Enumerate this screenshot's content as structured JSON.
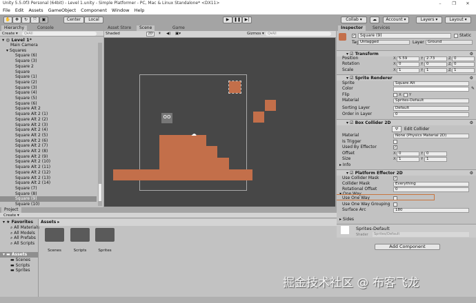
{
  "window": {
    "title": "Unity 5.5.0f3 Personal (64bit) - Level 1.unity - Simple Platformer - PC, Mac & Linux Standalone* <DX11>",
    "min": "–",
    "max": "❐",
    "close": "✕"
  },
  "menu": [
    "File",
    "Edit",
    "Assets",
    "GameObject",
    "Component",
    "Window",
    "Help"
  ],
  "toolbar": {
    "center": "Center",
    "local": "Local",
    "collab": "Collab ▾",
    "account": "Account ▾",
    "layers": "Layers ▾",
    "layout": "Layout ▾"
  },
  "hierarchy": {
    "tab": "Hierarchy",
    "console_tab": "Console",
    "create": "Create ▾",
    "search": "Q▾All",
    "scene": "Level 1*",
    "items": [
      "Main Camera",
      "Squares",
      "Square (6)",
      "Square (3)",
      "Square 2",
      "Square",
      "Square (1)",
      "Square (2)",
      "Square (3)",
      "Square (4)",
      "Square (5)",
      "Square (6)",
      "Square Alt 2",
      "Square Alt 2 (1)",
      "Square Alt 2 (2)",
      "Square Alt 2 (3)",
      "Square Alt 2 (4)",
      "Square Alt 2 (5)",
      "Square Alt 2 (6)",
      "Square Alt 2 (7)",
      "Square Alt 2 (8)",
      "Square Alt 2 (9)",
      "Square Alt 2 (10)",
      "Square Alt 2 (11)",
      "Square Alt 2 (12)",
      "Square Alt 2 (13)",
      "Square Alt 2 (14)",
      "Square (7)",
      "Square (8)",
      "Square (9)",
      "Square (10)"
    ],
    "selected": "Square (9)"
  },
  "scene": {
    "tabs": [
      "Asset Store",
      "Scene",
      "Game"
    ],
    "shading": "Shaded",
    "mode2d": "2D",
    "gizmos": "Gizmos ▾",
    "search": "Q▾All"
  },
  "project": {
    "tab": "Project",
    "create": "Create ▾",
    "favorites": "Favorites",
    "fav_items": [
      "All Materials",
      "All Models",
      "All Prefabs",
      "All Scripts"
    ],
    "assets": "Assets",
    "asset_items": [
      "Scenes",
      "Scripts",
      "Sprites"
    ],
    "breadcrumb": "Assets ▸",
    "folders": [
      "Scenes",
      "Scripts",
      "Sprites"
    ]
  },
  "inspector": {
    "tab": "Inspector",
    "services_tab": "Services",
    "name": "Square (9)",
    "static": "Static",
    "tag_label": "Tag",
    "tag": "Untagged",
    "layer_label": "Layer",
    "layer": "Ground",
    "transform": {
      "title": "Transform",
      "position": [
        "Position",
        "5.59",
        "2.73",
        "0"
      ],
      "rotation": [
        "Rotation",
        "0",
        "0",
        "0"
      ],
      "scale": [
        "Scale",
        "1",
        "1",
        "1"
      ]
    },
    "sprite_renderer": {
      "title": "Sprite Renderer",
      "sprite": [
        "Sprite",
        "Square Alt"
      ],
      "color": "Color",
      "flip": "Flip",
      "flip_x": "X",
      "flip_y": "Y",
      "material": [
        "Material",
        "Sprites-Default"
      ],
      "sorting": [
        "Sorting Layer",
        "Default"
      ],
      "order": [
        "Order in Layer",
        "0"
      ]
    },
    "box_collider": {
      "title": "Box Collider 2D",
      "edit": "Edit Collider",
      "material": [
        "Material",
        "None (Physics Material 2D)"
      ],
      "trigger": "Is Trigger",
      "effector": "Used By Effector",
      "offset": [
        "Offset",
        "0",
        "0"
      ],
      "size": [
        "Size",
        "1",
        "1"
      ],
      "info": "Info"
    },
    "platform_effector": {
      "title": "Platform Effector 2D",
      "use_mask": "Use Collider Mask",
      "mask": [
        "Collider Mask",
        "Everything"
      ],
      "rot": [
        "Rotational Offset",
        "0"
      ],
      "one_way": "One Way",
      "use_one_way": "Use One Way",
      "grouping": "Use One Way Grouping",
      "arc": [
        "Surface Arc",
        "180"
      ],
      "sides": "Sides"
    },
    "material": {
      "name": "Sprites-Default",
      "shader_label": "Shader",
      "shader": "Sprites/Default"
    },
    "add_component": "Add Component"
  },
  "watermark": "掘金技术社区 @ 布客飞龙",
  "colors": {
    "brick": "#c36f4a",
    "scene_bg": "#474747",
    "highlight": "#c8743c"
  }
}
